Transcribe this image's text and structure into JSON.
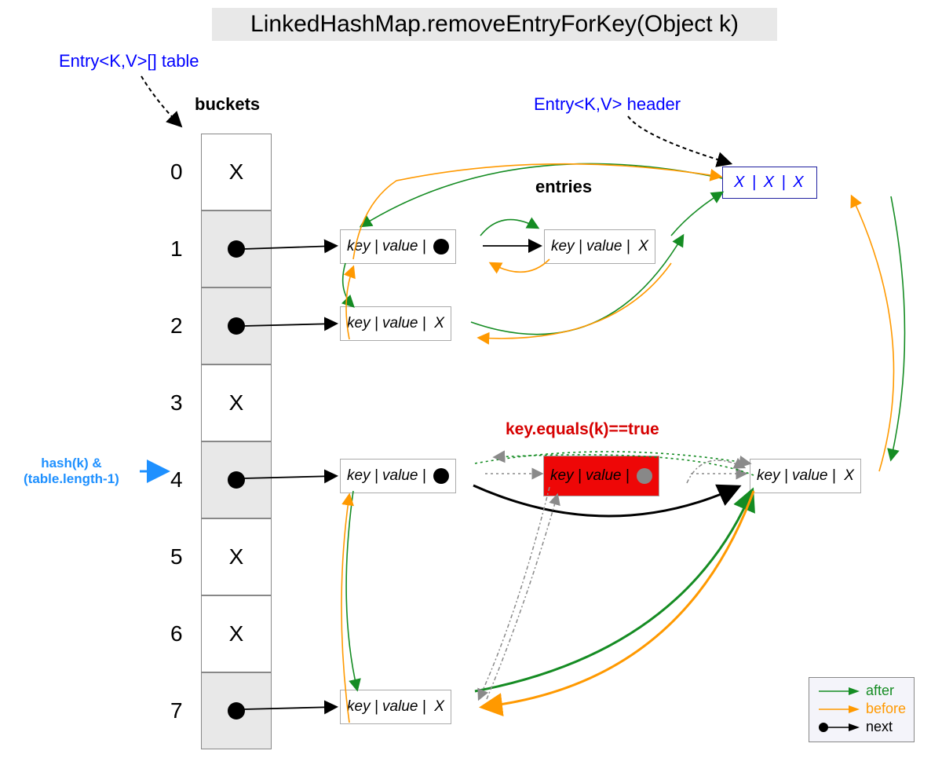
{
  "title": "LinkedHashMap.removeEntryForKey(Object k)",
  "label_table": "Entry<K,V>[] table",
  "label_buckets": "buckets",
  "label_header": "Entry<K,V> header",
  "label_entries": "entries",
  "label_equals": "key.equals(k)==true",
  "hash_line1": "hash(k) &",
  "hash_line2": "(table.length-1)",
  "header_box": "X  |  X  | X",
  "buckets": [
    {
      "index": "0",
      "content": "X",
      "shaded": false
    },
    {
      "index": "1",
      "content": "dot",
      "shaded": true
    },
    {
      "index": "2",
      "content": "dot",
      "shaded": true
    },
    {
      "index": "3",
      "content": "X",
      "shaded": false
    },
    {
      "index": "4",
      "content": "dot",
      "shaded": true
    },
    {
      "index": "5",
      "content": "X",
      "shaded": false
    },
    {
      "index": "6",
      "content": "X",
      "shaded": false
    },
    {
      "index": "7",
      "content": "dot",
      "shaded": true
    }
  ],
  "entries": {
    "e11": "key | value | ",
    "e12": "key | value |  X",
    "e21": "key | value |  X",
    "e41_k": "key | value | ",
    "e42_k": "key | value | ",
    "e43_k": "key | value |  X",
    "e71": "key | value |  X"
  },
  "legend": {
    "after": "after",
    "before": "before",
    "next": "next"
  }
}
